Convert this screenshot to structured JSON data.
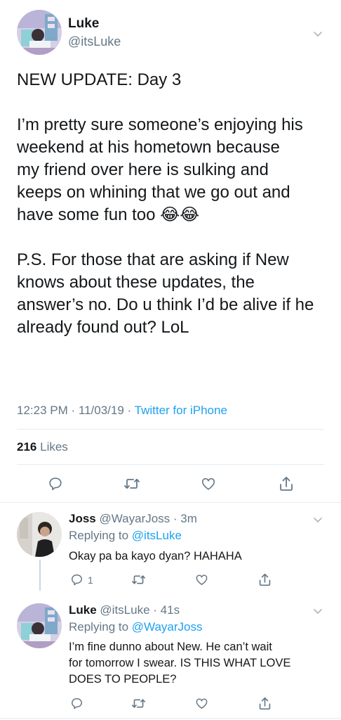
{
  "main_tweet": {
    "name": "Luke",
    "handle": "@itsLuke",
    "paragraphs": [
      [
        "NEW UPDATE: Day 3"
      ],
      [
        "I’m pretty sure someone’s enjoying his",
        "weekend at his hometown because",
        "my friend over here is sulking and",
        "keeps on whining that we go out and",
        "have some fun too 😂😂"
      ],
      [
        "P.S. For those that are asking if New",
        "knows about these updates, the",
        "answer’s no. Do u think I’d be alive if he",
        "already found out? LoL"
      ]
    ],
    "time": "12:23 PM",
    "date": "11/03/19",
    "source": "Twitter for iPhone",
    "likes_count": "216",
    "likes_label": "Likes"
  },
  "replies": [
    {
      "name": "Joss",
      "handle": "@WayarJoss",
      "time": "3m",
      "replying_label": "Replying to",
      "replying_to": "@itsLuke",
      "lines": [
        "Okay pa ba kayo dyan? HAHAHA"
      ],
      "reply_count": "1"
    },
    {
      "name": "Luke",
      "handle": "@itsLuke",
      "time": "41s",
      "replying_label": "Replying to",
      "replying_to": "@WayarJoss",
      "lines": [
        "I’m fine dunno about New. He can’t wait",
        "for tomorrow I swear. IS THIS WHAT LOVE",
        "DOES TO PEOPLE?"
      ],
      "reply_count": ""
    }
  ],
  "icons": {
    "reply": "reply-icon",
    "retweet": "retweet-icon",
    "like": "heart-icon",
    "share": "share-icon",
    "menu": "chevron-down-icon"
  },
  "colors": {
    "accent": "#1da1f2",
    "secondary_text": "#657786",
    "primary_text": "#14171a",
    "divider": "#e6ecf0"
  }
}
